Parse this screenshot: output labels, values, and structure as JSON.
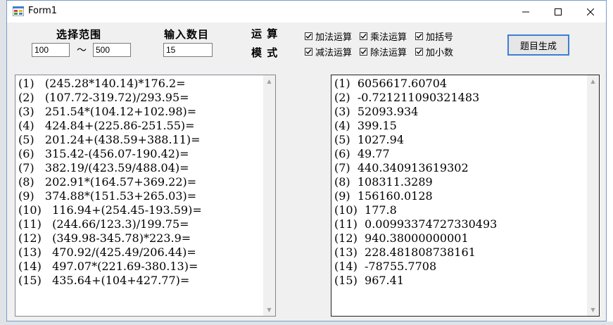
{
  "window": {
    "title": "Form1"
  },
  "range": {
    "label": "选择范围",
    "min": "100",
    "separator": "～",
    "max": "500"
  },
  "count": {
    "label": "输入数目",
    "value": "15"
  },
  "mode": {
    "label_line1": "运  算",
    "label_line2": "模  式"
  },
  "options": [
    {
      "label": "加法运算",
      "checked": true
    },
    {
      "label": "乘法运算",
      "checked": true
    },
    {
      "label": "加括号",
      "checked": true
    },
    {
      "label": "减法运算",
      "checked": true
    },
    {
      "label": "除法运算",
      "checked": true
    },
    {
      "label": "加小数",
      "checked": true
    }
  ],
  "generate_button": "题目生成",
  "questions": [
    "(1)   (245.28*140.14)*176.2=",
    "(2)   (107.72-319.72)/293.95=",
    "(3)   251.54*(104.12+102.98)=",
    "(4)   424.84+(225.86-251.55)=",
    "(5)   201.24+(438.59+388.11)=",
    "(6)   315.42-(456.07-190.42)=",
    "(7)   382.19/(423.59/488.04)=",
    "(8)   202.91*(164.57+369.22)=",
    "(9)   374.88*(151.53+265.03)=",
    "(10)   116.94+(254.45-193.59)=",
    "(11)   (244.66/123.3)/199.75=",
    "(12)   (349.98-345.78)*223.9=",
    "(13)   470.92/(425.49/206.44)=",
    "(14)   497.07*(221.69-380.13)=",
    "(15)   435.64+(104+427.77)="
  ],
  "answers": [
    "(1)  6056617.60704",
    "(2)  -0.721211090321483",
    "(3)  52093.934",
    "(4)  399.15",
    "(5)  1027.94",
    "(6)  49.77",
    "(7)  440.340913619302",
    "(8)  108311.3289",
    "(9)  156160.0128",
    "(10)  177.8",
    "(11)  0.00993374727330493",
    "(12)  940.38000000001",
    "(13)  228.481808738161",
    "(14)  -78755.7708",
    "(15)  967.41"
  ]
}
